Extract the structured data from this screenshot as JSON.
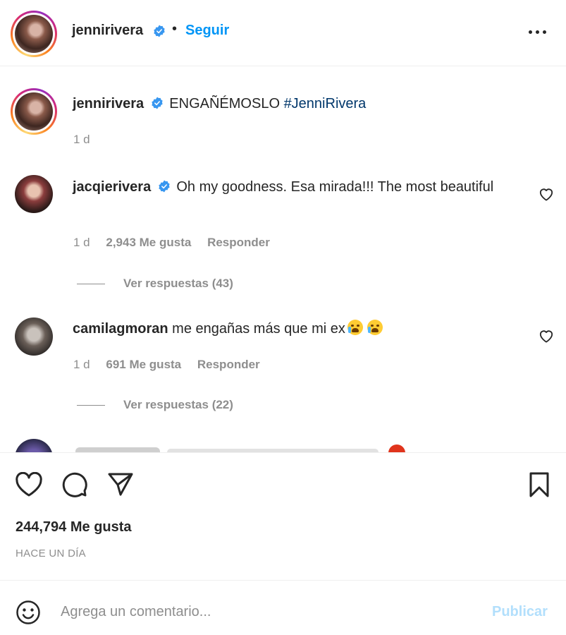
{
  "post": {
    "username": "jennirivera",
    "follow_label": "Seguir",
    "dot": "•"
  },
  "caption": {
    "username": "jennirivera",
    "text": "ENGAÑÉMOSLO",
    "hashtag": "#JenniRivera",
    "time": "1 d"
  },
  "comments": [
    {
      "username": "jacqierivera",
      "verified": true,
      "text": "Oh my goodness. Esa mirada!!! The most beautiful",
      "time": "1 d",
      "likes": "2,943 Me gusta",
      "reply": "Responder",
      "view_replies": "Ver respuestas (43)"
    },
    {
      "username": "camilagmoran",
      "verified": false,
      "text": "me engañas más que mi ex",
      "emojis": [
        "loudly-crying-face",
        "loudly-crying-face"
      ],
      "time": "1 d",
      "likes": "691 Me gusta",
      "reply": "Responder",
      "view_replies": "Ver respuestas (22)"
    }
  ],
  "actions": {
    "likes_total": "244,794 Me gusta",
    "posted": "HACE UN DÍA"
  },
  "composer": {
    "placeholder": "Agrega un comentario...",
    "publish_label": "Publicar"
  },
  "colors": {
    "link_blue": "#0095f6",
    "hashtag": "#00376b",
    "muted": "#8e8e8e",
    "publish_disabled": "#b2dffc",
    "verified": "#3897f0"
  },
  "icons": [
    "more-options-icon",
    "verified-icon",
    "heart-icon",
    "comment-icon",
    "share-icon",
    "bookmark-icon",
    "emoji-icon"
  ]
}
